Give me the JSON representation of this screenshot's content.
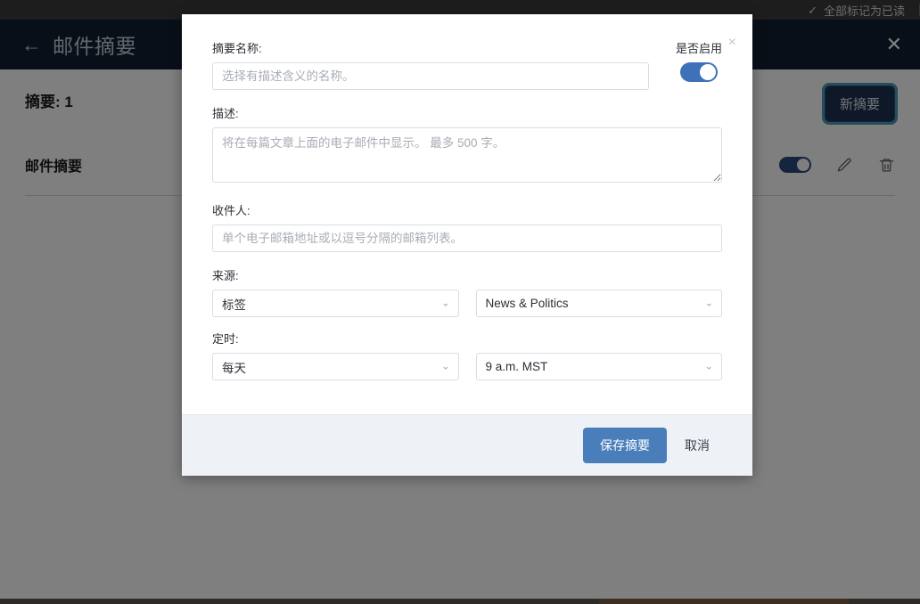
{
  "browser_bar": {
    "mark_all_read_label": "全部标记为已读",
    "check_icon": "✓"
  },
  "app_header": {
    "back_icon": "←",
    "title": "邮件摘要",
    "close_icon": "✕"
  },
  "page": {
    "digest_count_label": "摘要: 1",
    "section_title": "邮件摘要",
    "new_digest_button": "新摘要"
  },
  "modal": {
    "close_icon": "×",
    "name": {
      "label": "摘要名称:",
      "placeholder": "选择有描述含义的名称。",
      "value": ""
    },
    "enabled": {
      "label": "是否启用",
      "state": "on"
    },
    "description": {
      "label": "描述:",
      "placeholder": "将在每篇文章上面的电子邮件中显示。 最多 500 字。",
      "value": ""
    },
    "recipients": {
      "label": "收件人:",
      "placeholder": "单个电子邮箱地址或以逗号分隔的邮箱列表。",
      "value": ""
    },
    "source": {
      "label": "来源:",
      "type_value": "标签",
      "target_value": "News & Politics"
    },
    "schedule": {
      "label": "定时:",
      "frequency_value": "每天",
      "time_value": "9 a.m. MST"
    },
    "footer": {
      "save_label": "保存摘要",
      "cancel_label": "取消"
    },
    "chevron_icon": "⌄"
  },
  "colors": {
    "header_navy": "#121e33",
    "primary_blue": "#4a7ebb",
    "toggle_blue": "#3d72b8",
    "footer_bg": "#eef2f7",
    "focus_ring": "#4a9bb5"
  }
}
